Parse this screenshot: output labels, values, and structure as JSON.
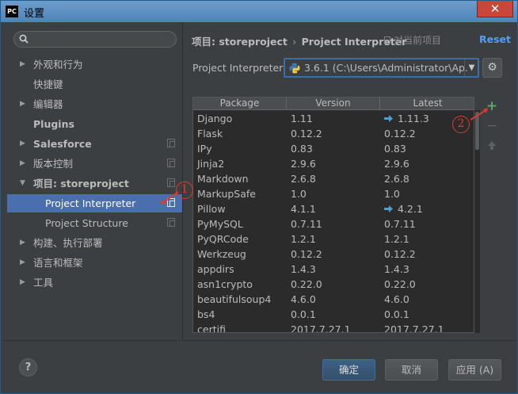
{
  "window": {
    "app_icon_text": "PC",
    "title": "设置",
    "close_glyph": "✕"
  },
  "sidebar": {
    "search_placeholder": "",
    "items": [
      {
        "label": "外观和行为",
        "arrow": "▶"
      },
      {
        "label": "快捷键"
      },
      {
        "label": "编辑器",
        "arrow": "▶"
      },
      {
        "label": "Plugins"
      },
      {
        "label": "Salesforce",
        "arrow": "▶"
      },
      {
        "label": "版本控制",
        "arrow": "▶"
      },
      {
        "label": "项目: storeproject",
        "arrow": "▼"
      },
      {
        "label": "Project Interpreter"
      },
      {
        "label": "Project Structure"
      },
      {
        "label": "构建、执行部署",
        "arrow": "▶"
      },
      {
        "label": "语言和框架",
        "arrow": "▶"
      },
      {
        "label": "工具",
        "arrow": "▶"
      }
    ]
  },
  "breadcrumb": {
    "project": "项目: storeproject",
    "separator": "›",
    "page": "Project Interpreter"
  },
  "for_current_project": "对当前项目",
  "reset_label": "Reset",
  "interpreter": {
    "label": "Project Interpreter:",
    "value": "3.6.1 (C:\\Users\\Administrator\\Ap..."
  },
  "table": {
    "columns": [
      "Package",
      "Version",
      "Latest"
    ],
    "rows": [
      {
        "package": "Django",
        "version": "1.11",
        "latest": "1.11.3",
        "upgrade": true
      },
      {
        "package": "Flask",
        "version": "0.12.2",
        "latest": "0.12.2"
      },
      {
        "package": "IPy",
        "version": "0.83",
        "latest": "0.83"
      },
      {
        "package": "Jinja2",
        "version": "2.9.6",
        "latest": "2.9.6"
      },
      {
        "package": "Markdown",
        "version": "2.6.8",
        "latest": "2.6.8"
      },
      {
        "package": "MarkupSafe",
        "version": "1.0",
        "latest": "1.0"
      },
      {
        "package": "Pillow",
        "version": "4.1.1",
        "latest": "4.2.1",
        "upgrade": true
      },
      {
        "package": "PyMySQL",
        "version": "0.7.11",
        "latest": "0.7.11"
      },
      {
        "package": "PyQRCode",
        "version": "1.2.1",
        "latest": "1.2.1"
      },
      {
        "package": "Werkzeug",
        "version": "0.12.2",
        "latest": "0.12.2"
      },
      {
        "package": "appdirs",
        "version": "1.4.3",
        "latest": "1.4.3"
      },
      {
        "package": "asn1crypto",
        "version": "0.22.0",
        "latest": "0.22.0"
      },
      {
        "package": "beautifulsoup4",
        "version": "4.6.0",
        "latest": "4.6.0"
      },
      {
        "package": "bs4",
        "version": "0.0.1",
        "latest": "0.0.1"
      },
      {
        "package": "certifi",
        "version": "2017.7.27.1",
        "latest": "2017.7.27.1"
      }
    ]
  },
  "side_tools": {
    "add": "+",
    "remove": "−"
  },
  "annotations": [
    "1",
    "2"
  ],
  "buttons": {
    "help": "?",
    "ok": "确定",
    "cancel": "取消",
    "apply": "应用 (A)"
  },
  "colors": {
    "accent": "#4b6eaf",
    "link": "#589df6",
    "add": "#59a869",
    "annotation": "#e03a2a"
  }
}
